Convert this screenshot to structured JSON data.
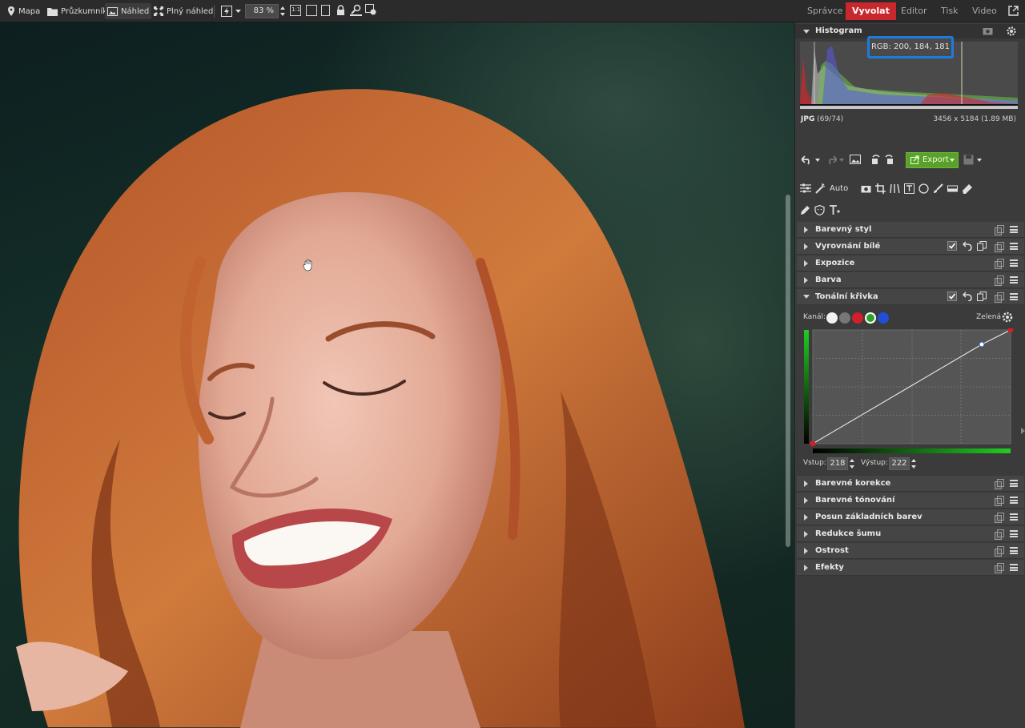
{
  "toolbar": {
    "mapa": "Mapa",
    "pruzkumnik": "Průzkumník",
    "nahled": "Náhled",
    "plny_nahled": "Plný náhled",
    "zoom": "83 %",
    "modes": [
      "Správce",
      "Vyvolat",
      "Editor",
      "Tisk",
      "Video"
    ],
    "active_mode": "Vyvolat"
  },
  "histogram": {
    "title": "Histogram",
    "rgb_readout": "RGB: 200, 184, 181",
    "format": "JPG",
    "index": "(69/74)",
    "dimensions": "3456 x 5184 (1.89 MB)"
  },
  "actions": {
    "export_label": "Export",
    "auto_label": "Auto"
  },
  "sections": [
    {
      "label": "Barevný styl",
      "expanded": false
    },
    {
      "label": "Vyrovnání bílé",
      "expanded": false,
      "enabled": true
    },
    {
      "label": "Expozice",
      "expanded": false
    },
    {
      "label": "Barva",
      "expanded": false
    },
    {
      "label": "Tonální křivka",
      "expanded": true,
      "enabled": true
    }
  ],
  "tone_curve": {
    "kanal_label": "Kanál:",
    "channel_name": "Zelená",
    "channels": [
      "white",
      "gray",
      "red",
      "green",
      "blue"
    ],
    "selected_channel": "green",
    "vstup_label": "Vstup:",
    "vstup_value": "218",
    "vystup_label": "Výstup:",
    "vystup_value": "222"
  },
  "sections_after": [
    {
      "label": "Barevné korekce"
    },
    {
      "label": "Barevné tónování"
    },
    {
      "label": "Posun základních barev"
    },
    {
      "label": "Redukce šumu"
    },
    {
      "label": "Ostrost"
    },
    {
      "label": "Efekty"
    }
  ],
  "colors": {
    "accent_red": "#c8282d",
    "export_green": "#5aa02c",
    "highlight_blue": "#1d7be0"
  }
}
